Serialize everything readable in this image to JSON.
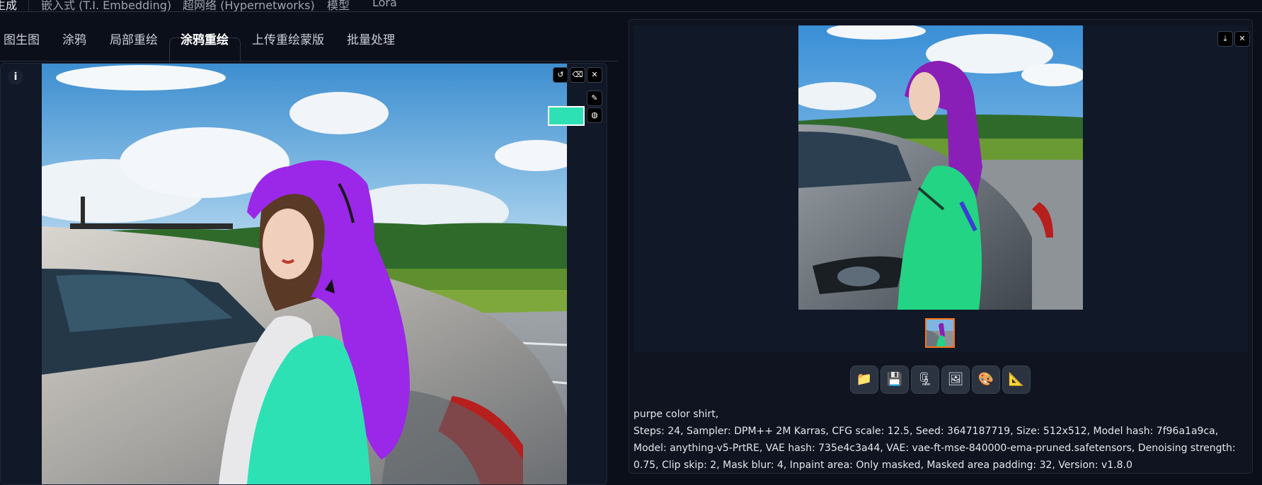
{
  "top_nav": {
    "items": [
      "生成",
      "嵌入式 (T.I. Embedding)",
      "超网络 (Hypernetworks)",
      "模型",
      "Lora"
    ]
  },
  "tabs": [
    "图生图",
    "涂鸦",
    "局部重绘",
    "涂鸦重绘",
    "上传重绘蒙版",
    "批量处理"
  ],
  "active_tab": "涂鸦重绘",
  "canvas": {
    "info_label": "i",
    "brush_color": "#2de1b5",
    "icons": [
      "undo-icon",
      "eraser-icon",
      "close-icon",
      "brush-size-icon",
      "color-palette-icon"
    ]
  },
  "gallery": {
    "icons": [
      "download-icon",
      "close-icon"
    ],
    "thumbnail_count": 1
  },
  "toolbar": {
    "buttons": [
      {
        "name": "open-folder-button",
        "glyph": "📁"
      },
      {
        "name": "save-button",
        "glyph": "💾"
      },
      {
        "name": "zip-button",
        "glyph": "🗜"
      },
      {
        "name": "send-to-img2img-button",
        "glyph": "🖼"
      },
      {
        "name": "send-to-inpaint-button",
        "glyph": "🎨"
      },
      {
        "name": "send-to-extras-button",
        "glyph": "📐"
      }
    ]
  },
  "generation_info": {
    "prompt": "purpe color shirt,",
    "params": "Steps: 24, Sampler: DPM++ 2M Karras, CFG scale: 12.5, Seed: 3647187719, Size: 512x512, Model hash: 7f96a1a9ca, Model: anything-v5-PrtRE, VAE hash: 735e4c3a44, VAE: vae-ft-mse-840000-ema-pruned.safetensors, Denoising strength: 0.75, Clip skip: 2, Mask blur: 4, Inpaint area: Only masked, Masked area padding: 32, Version: v1.8.0"
  },
  "colors": {
    "background": "#0b0f19",
    "mask_purple": "#9b27e8",
    "mask_green": "#2de1b5",
    "thumb_border": "#f97316"
  }
}
